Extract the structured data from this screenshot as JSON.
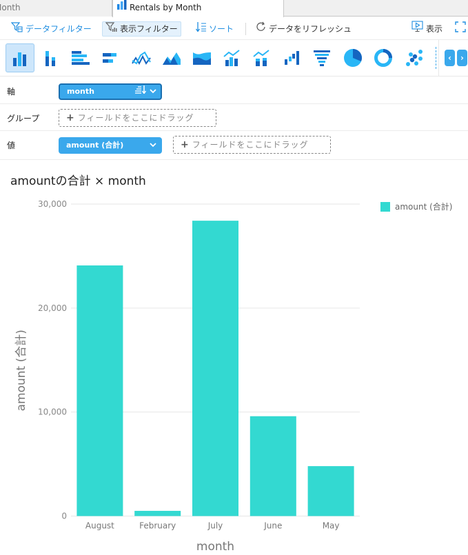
{
  "tabs": [
    {
      "label": "Month",
      "active": false
    },
    {
      "label": "Rentals by Month",
      "active": true
    }
  ],
  "toolbar": {
    "data_filter": "データフィルター",
    "view_filter": "表示フィルター",
    "sort": "ソート",
    "refresh": "データをリフレッシュ",
    "display": "表示"
  },
  "chart_types": [
    {
      "name": "clustered-column",
      "selected": true
    },
    {
      "name": "stacked-column",
      "selected": false
    },
    {
      "name": "clustered-bar",
      "selected": false
    },
    {
      "name": "stacked-bar",
      "selected": false
    },
    {
      "name": "line",
      "selected": false
    },
    {
      "name": "area",
      "selected": false
    },
    {
      "name": "stacked-area",
      "selected": false
    },
    {
      "name": "column-line-combo",
      "selected": false
    },
    {
      "name": "stacked-column-line-combo",
      "selected": false
    },
    {
      "name": "waterfall",
      "selected": false
    },
    {
      "name": "funnel",
      "selected": false
    },
    {
      "name": "pie",
      "selected": false
    },
    {
      "name": "donut",
      "selected": false
    },
    {
      "name": "scatter",
      "selected": false
    }
  ],
  "shelves": {
    "axis": {
      "label": "軸",
      "field": "month"
    },
    "group": {
      "label": "グループ",
      "placeholder": "フィールドをここにドラッグ"
    },
    "value": {
      "label": "値",
      "field": "amount (合計)",
      "placeholder": "フィールドをここにドラッグ"
    }
  },
  "colors": {
    "accent": "#3aa8ec",
    "bar": "#33d9d1"
  },
  "chart_data": {
    "type": "bar",
    "title": "amountの合計 × month",
    "categories": [
      "August",
      "February",
      "July",
      "June",
      "May"
    ],
    "series": [
      {
        "name": "amount (合計)",
        "values": [
          24100,
          500,
          28400,
          9600,
          4800
        ]
      }
    ],
    "xlabel": "month",
    "ylabel": "amount (合計)",
    "ylim": [
      0,
      30000
    ],
    "yticks": [
      0,
      10000,
      20000,
      30000
    ],
    "ytick_labels": [
      "0",
      "10,000",
      "20,000",
      "30,000"
    ],
    "grid": true,
    "legend": "top-right"
  }
}
